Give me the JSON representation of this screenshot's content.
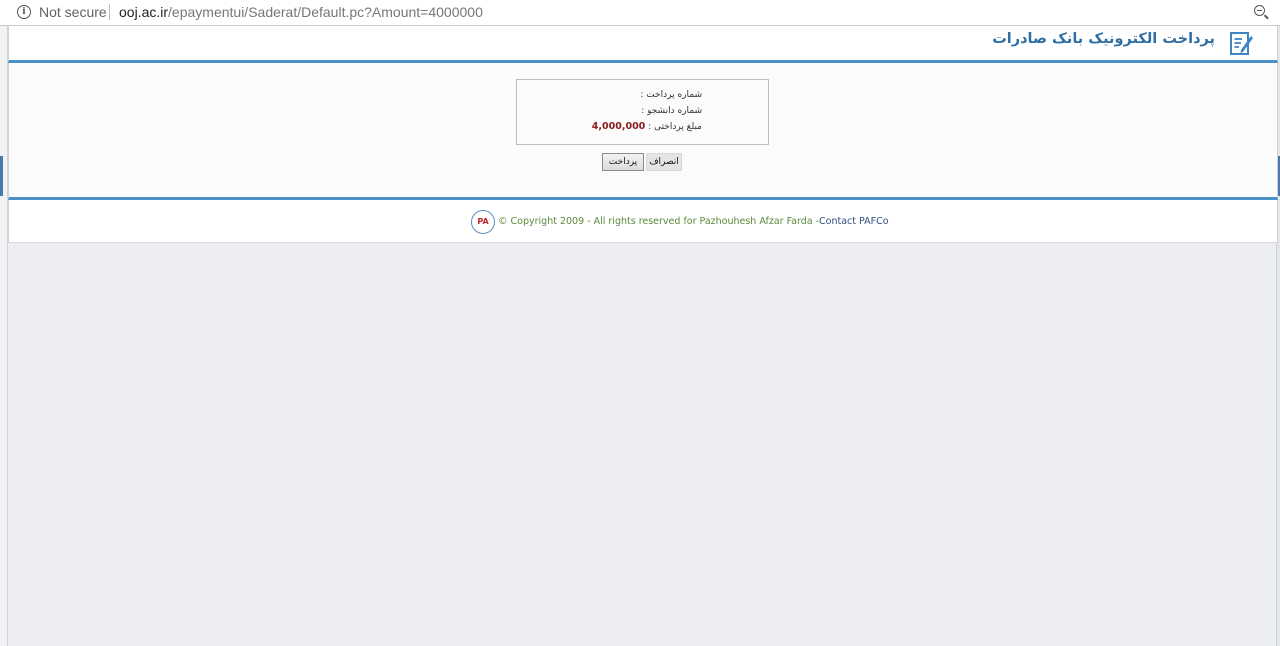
{
  "browser": {
    "security_label": "Not secure",
    "url_host": "ooj.ac.ir",
    "url_path": "/epaymentui/Saderat/Default.pc?Amount=4000000"
  },
  "header": {
    "title": "پرداخت الکترونیک بانک صادرات",
    "accent_color": "#4a90c2"
  },
  "payment": {
    "payment_number_label": "شماره پرداخت :",
    "student_number_label": "شماره دانشجو :",
    "amount_label": "مبلغ پرداختی :",
    "amount_value": "4,000,000",
    "pay_button": "پرداخت",
    "cancel_button": "انصراف"
  },
  "footer": {
    "logo_text": "PA",
    "copyright": "© Copyright 2009 - All rights reserved for Pazhouhesh Afzar Farda -",
    "contact": "Contact PAFCo"
  }
}
